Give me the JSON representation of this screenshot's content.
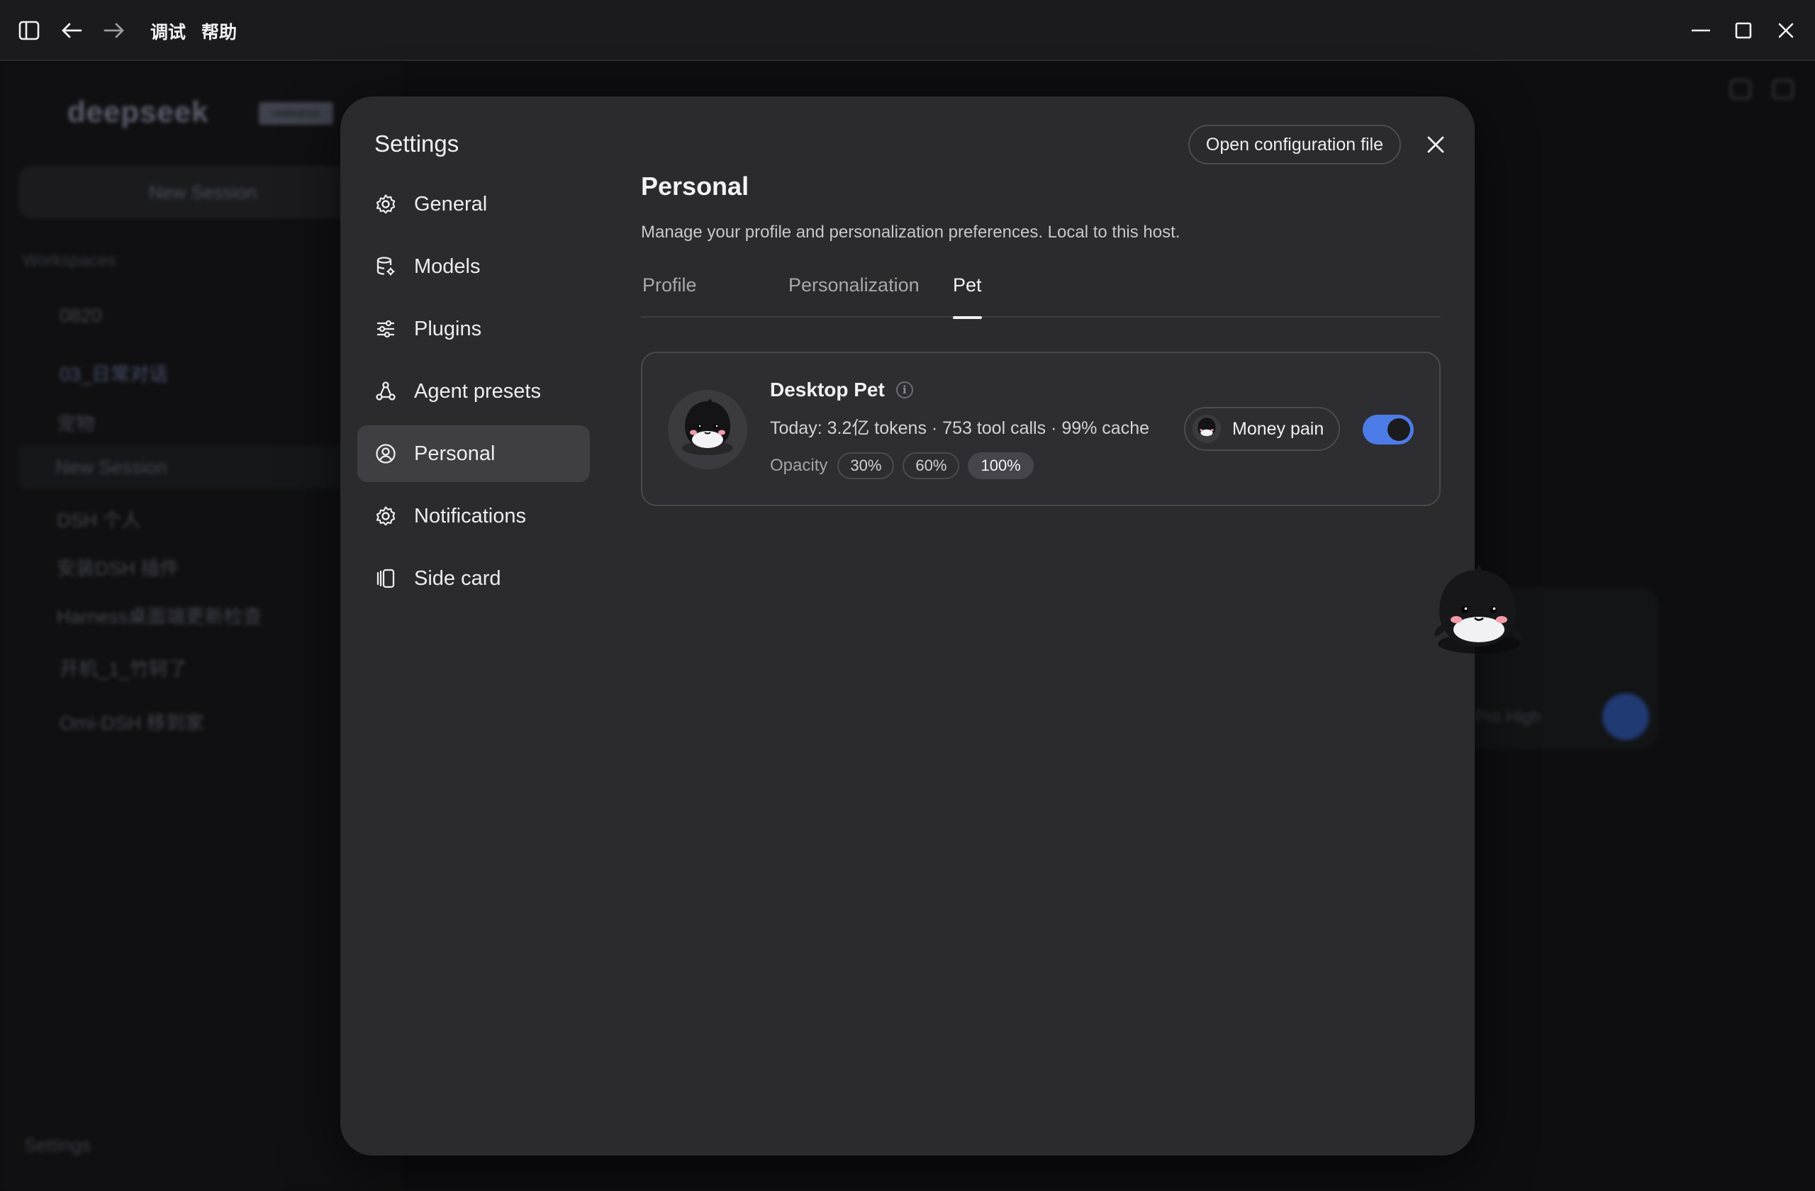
{
  "menubar": {
    "items": [
      "调试",
      "帮助"
    ]
  },
  "background": {
    "logo": "deepseek",
    "logo_badge": "HARNESS",
    "new_session": "New Session",
    "workspaces_label": "Workspaces",
    "items": [
      "0820",
      "03_日常对话",
      "宠物",
      "New Session",
      "DSH 个人",
      "安装DSH 插件",
      "Harness桌面端更新检查",
      "开机_1_竹轲了",
      "Omi-DSH 移到家"
    ],
    "settings": "Settings",
    "composer_model": "Pro High"
  },
  "settings": {
    "title": "Settings",
    "open_config": "Open configuration file",
    "nav": [
      {
        "label": "General",
        "icon": "gear-icon"
      },
      {
        "label": "Models",
        "icon": "database-icon"
      },
      {
        "label": "Plugins",
        "icon": "sliders-icon"
      },
      {
        "label": "Agent presets",
        "icon": "nodes-icon"
      },
      {
        "label": "Personal",
        "icon": "user-circle-icon",
        "active": true
      },
      {
        "label": "Notifications",
        "icon": "gear-icon"
      },
      {
        "label": "Side card",
        "icon": "side-card-icon"
      }
    ]
  },
  "personal": {
    "title": "Personal",
    "description": "Manage your profile and personalization preferences. Local to this host.",
    "tabs": [
      "Profile",
      "Personalization",
      "Pet"
    ],
    "active_tab": "Pet"
  },
  "pet": {
    "name": "Desktop Pet",
    "stats": "Today: 3.2亿 tokens · 753 tool calls · 99% cache",
    "opacity_label": "Opacity",
    "opacity_options": [
      "30%",
      "60%",
      "100%"
    ],
    "opacity_selected": "100%",
    "selected_pet": "Money pain",
    "enabled": true,
    "accent": "#4d7ce8"
  }
}
